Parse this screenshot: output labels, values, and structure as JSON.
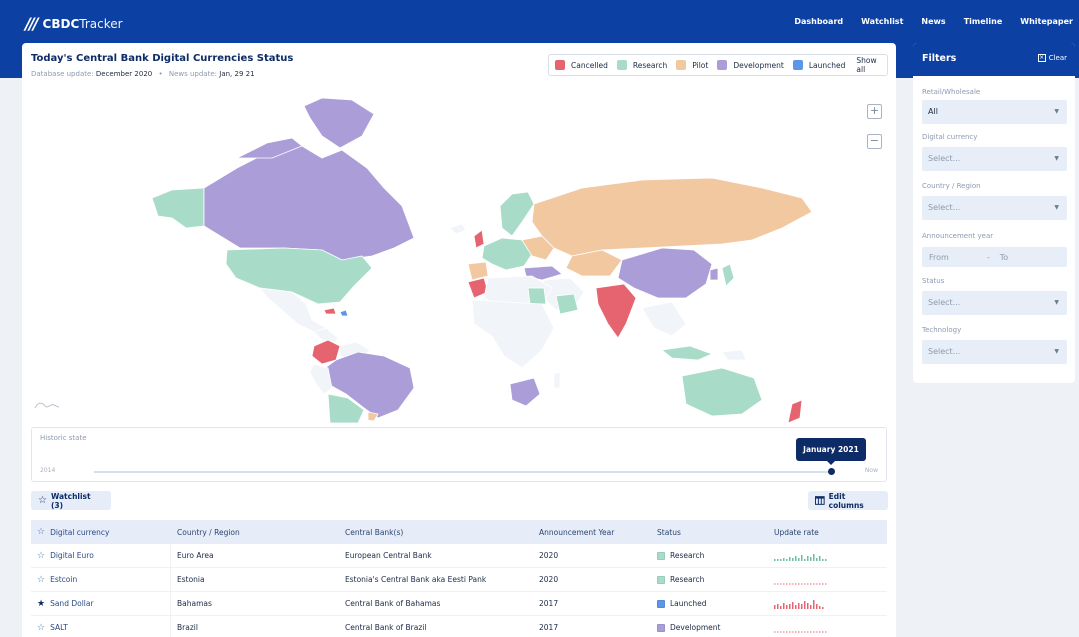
{
  "header": {
    "logo_mark": "///",
    "logo_strong": "CBDC",
    "logo_light": "Tracker",
    "nav": [
      "Dashboard",
      "Watchlist",
      "News",
      "Timeline",
      "Whitepaper"
    ]
  },
  "status_card": {
    "title": "Today's Central Bank Digital Currencies Status",
    "db_label": "Database update:",
    "db_value": "December 2020",
    "news_label": "News update:",
    "news_value": "Jan, 29 21",
    "legend": [
      {
        "label": "Cancelled",
        "color": "#e5646f"
      },
      {
        "label": "Research",
        "color": "#a8dcc9"
      },
      {
        "label": "Pilot",
        "color": "#f2c8a0"
      },
      {
        "label": "Development",
        "color": "#ab9ed8"
      },
      {
        "label": "Launched",
        "color": "#5b97e6"
      }
    ],
    "show_all": "Show all",
    "zoom_in": "+",
    "zoom_out": "−"
  },
  "history": {
    "label": "Historic state",
    "start": "2014",
    "end": "Now",
    "current": "January 2021"
  },
  "toolbar": {
    "watchlist": "Watchlist (3)",
    "edit_columns": "Edit columns"
  },
  "table": {
    "headers": [
      "Digital currency",
      "Country / Region",
      "Central Bank(s)",
      "Announcement Year",
      "Status",
      "Update rate"
    ],
    "rows": [
      {
        "name": "Digital Euro",
        "country": "Euro Area",
        "bank": "European Central Bank",
        "year": "2020",
        "status": "Research",
        "status_color": "#a8dcc9",
        "starred": false
      },
      {
        "name": "Estcoin",
        "country": "Estonia",
        "bank": "Estonia's Central Bank aka Eesti Pank",
        "year": "2020",
        "status": "Research",
        "status_color": "#a8dcc9",
        "starred": false
      },
      {
        "name": "Sand Dollar",
        "country": "Bahamas",
        "bank": "Central Bank of Bahamas",
        "year": "2017",
        "status": "Launched",
        "status_color": "#5b97e6",
        "starred": true
      },
      {
        "name": "SALT",
        "country": "Brazil",
        "bank": "Central Bank of Brazil",
        "year": "2017",
        "status": "Development",
        "status_color": "#ab9ed8",
        "starred": false
      }
    ]
  },
  "filters": {
    "title": "Filters",
    "clear": "Clear",
    "retail_label": "Retail/Wholesale",
    "retail_value": "All",
    "currency_label": "Digital currency",
    "currency_placeholder": "Select...",
    "country_label": "Country / Region",
    "country_placeholder": "Select...",
    "year_label": "Announcement year",
    "year_from": "From",
    "year_sep": "-",
    "year_to": "To",
    "status_label": "Status",
    "status_placeholder": "Select...",
    "tech_label": "Technology",
    "tech_placeholder": "Select..."
  }
}
